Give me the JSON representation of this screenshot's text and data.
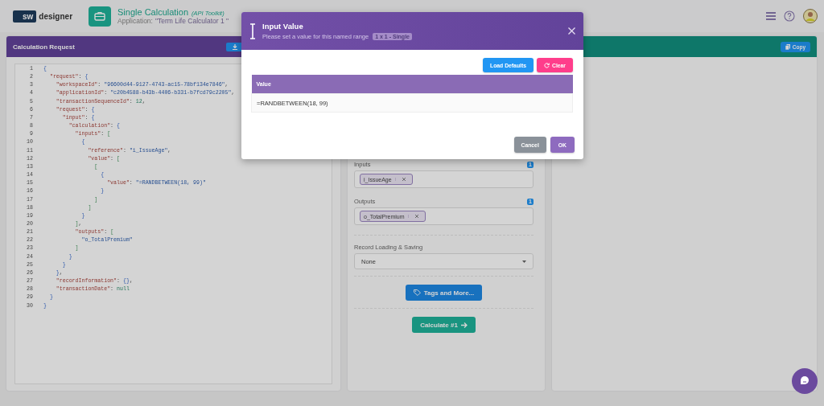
{
  "header": {
    "logo_badge": "sw",
    "logo_text": "designer",
    "title": "Single Calculation",
    "title_note": "(API Toolkit)",
    "subtitle_label": "Application:",
    "subtitle_value": "\"Term Life Calculator 1 \""
  },
  "request_panel": {
    "title": "Calculation Request",
    "code_lines": [
      {
        "number": "1",
        "text": "{"
      },
      {
        "number": "2",
        "text": "  \"request\": {"
      },
      {
        "number": "3",
        "text": "    \"workspaceId\": \"96600d44-9127-4743-ac15-78bf134e7846\","
      },
      {
        "number": "4",
        "text": "    \"applicationId\": \"c20b4588-b43b-4406-b331-b7fcd79c2205\","
      },
      {
        "number": "5",
        "text": "    \"transactionSequenceId\": 12,"
      },
      {
        "number": "6",
        "text": "    \"request\": {"
      },
      {
        "number": "7",
        "text": "      \"input\": {"
      },
      {
        "number": "8",
        "text": "        \"calculation\": {"
      },
      {
        "number": "9",
        "text": "          \"inputs\": ["
      },
      {
        "number": "10",
        "text": "            {"
      },
      {
        "number": "11",
        "text": "              \"reference\": \"i_IssueAge\","
      },
      {
        "number": "12",
        "text": "              \"value\": ["
      },
      {
        "number": "13",
        "text": "                ["
      },
      {
        "number": "14",
        "text": "                  {"
      },
      {
        "number": "15",
        "text": "                    \"value\": \"=RANDBETWEEN(18, 99)\""
      },
      {
        "number": "16",
        "text": "                  }"
      },
      {
        "number": "17",
        "text": "                ]"
      },
      {
        "number": "18",
        "text": "              ]"
      },
      {
        "number": "19",
        "text": "            }"
      },
      {
        "number": "20",
        "text": "          ],"
      },
      {
        "number": "21",
        "text": "          \"outputs\": ["
      },
      {
        "number": "22",
        "text": "            \"o_TotalPremium\""
      },
      {
        "number": "23",
        "text": "          ]"
      },
      {
        "number": "24",
        "text": "        }"
      },
      {
        "number": "25",
        "text": "      }"
      },
      {
        "number": "26",
        "text": "    },"
      },
      {
        "number": "27",
        "text": "    \"recordInformation\": {},"
      },
      {
        "number": "28",
        "text": "    \"transactionDate\": null"
      },
      {
        "number": "29",
        "text": "  }"
      },
      {
        "number": "30",
        "text": "}"
      }
    ]
  },
  "calc_panel": {
    "fields": [
      {
        "kind": "tags",
        "label": "Inputs",
        "count": "1",
        "tags": [
          "i_IssueAge"
        ]
      },
      {
        "kind": "tags",
        "label": "Outputs",
        "count": "1",
        "tags": [
          "o_TotalPremium"
        ]
      },
      {
        "kind": "select",
        "label": "Record Loading & Saving",
        "value": "None"
      }
    ],
    "tags_button": "Tags and More...",
    "calculate_button": "Calculate #1"
  },
  "response_panel": {
    "copy_button": "Copy"
  },
  "dialog": {
    "title": "Input Value",
    "subtitle": "Please set a value for this named range",
    "badge": "1 x 1 - Single",
    "load_defaults_button": "Load Defaults",
    "clear_button": "Clear",
    "column": "Value",
    "rows": [
      "=RANDBETWEEN(18, 99)"
    ],
    "cancel_button": "Cancel",
    "ok_button": "OK"
  }
}
